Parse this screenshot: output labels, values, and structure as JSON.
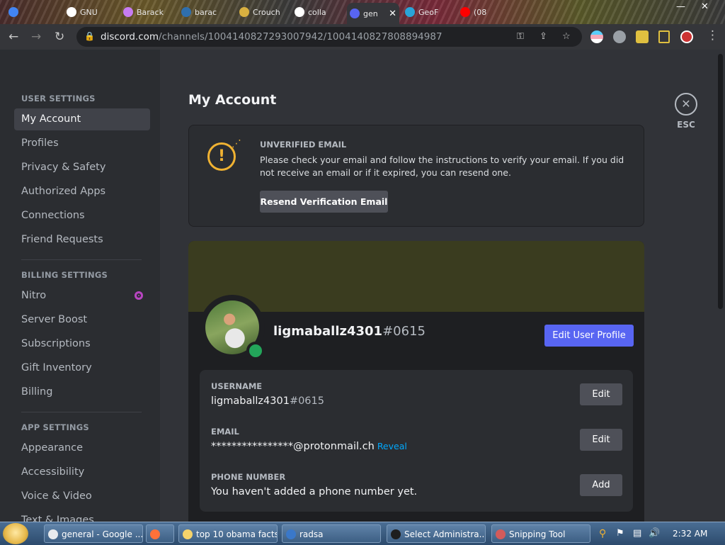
{
  "browser": {
    "tabs": [
      {
        "title": "",
        "icon": "google-icon",
        "color": "#4285f4"
      },
      {
        "title": "GNU",
        "icon": "openai-icon",
        "color": "#ffffff"
      },
      {
        "title": "Barack",
        "icon": "app-icon",
        "color": "#c77cf2"
      },
      {
        "title": "barac",
        "icon": "bing-icon",
        "color": "#2f6fad"
      },
      {
        "title": "Crouch",
        "icon": "app-icon",
        "color": "#d8b040"
      },
      {
        "title": "colla",
        "icon": "github-icon",
        "color": "#ffffff"
      },
      {
        "title": "gen",
        "icon": "discord-icon",
        "color": "#5865f2"
      },
      {
        "title": "GeoF",
        "icon": "app-icon",
        "color": "#2aa4d8"
      },
      {
        "title": "(08",
        "icon": "youtube-icon",
        "color": "#ff0000"
      }
    ],
    "url_host": "discord.com",
    "url_path": "/channels/1004140827293007942/1004140827808894987"
  },
  "sidebar": {
    "user_settings_heading": "USER SETTINGS",
    "user_items": [
      "My Account",
      "Profiles",
      "Privacy & Safety",
      "Authorized Apps",
      "Connections",
      "Friend Requests"
    ],
    "billing_heading": "BILLING SETTINGS",
    "billing_items": [
      "Nitro",
      "Server Boost",
      "Subscriptions",
      "Gift Inventory",
      "Billing"
    ],
    "app_heading": "APP SETTINGS",
    "app_items": [
      "Appearance",
      "Accessibility",
      "Voice & Video",
      "Text & Images"
    ]
  },
  "main": {
    "title": "My Account",
    "esc_label": "ESC",
    "notice": {
      "title": "UNVERIFIED EMAIL",
      "body": "Please check your email and follow the instructions to verify your email. If you did not receive an email or if it expired, you can resend one.",
      "button": "Resend Verification Email"
    },
    "profile": {
      "username": "ligmaballz4301",
      "discriminator": "#0615",
      "edit_button": "Edit User Profile",
      "banner_color": "#3a3c1f",
      "status_color": "#23a55a"
    },
    "fields": {
      "username_label": "USERNAME",
      "username_value": "ligmaballz4301",
      "username_disc": "#0615",
      "username_button": "Edit",
      "email_label": "EMAIL",
      "email_value": "****************@protonmail.ch",
      "email_reveal": "Reveal",
      "email_button": "Edit",
      "phone_label": "PHONE NUMBER",
      "phone_value": "You haven't added a phone number yet.",
      "phone_button": "Add"
    }
  },
  "taskbar": {
    "items": [
      {
        "label": "general - Google ...",
        "color": "#e8eaed"
      },
      {
        "label": "",
        "color": "#ff7139"
      },
      {
        "label": "top 10 obama facts",
        "color": "#f5d36b"
      },
      {
        "label": "radsa",
        "color": "#3a78c9"
      },
      {
        "label": "Select Administra...",
        "color": "#1e1e1e"
      },
      {
        "label": "Snipping Tool",
        "color": "#d35b5b"
      }
    ],
    "clock": "2:32 AM"
  }
}
